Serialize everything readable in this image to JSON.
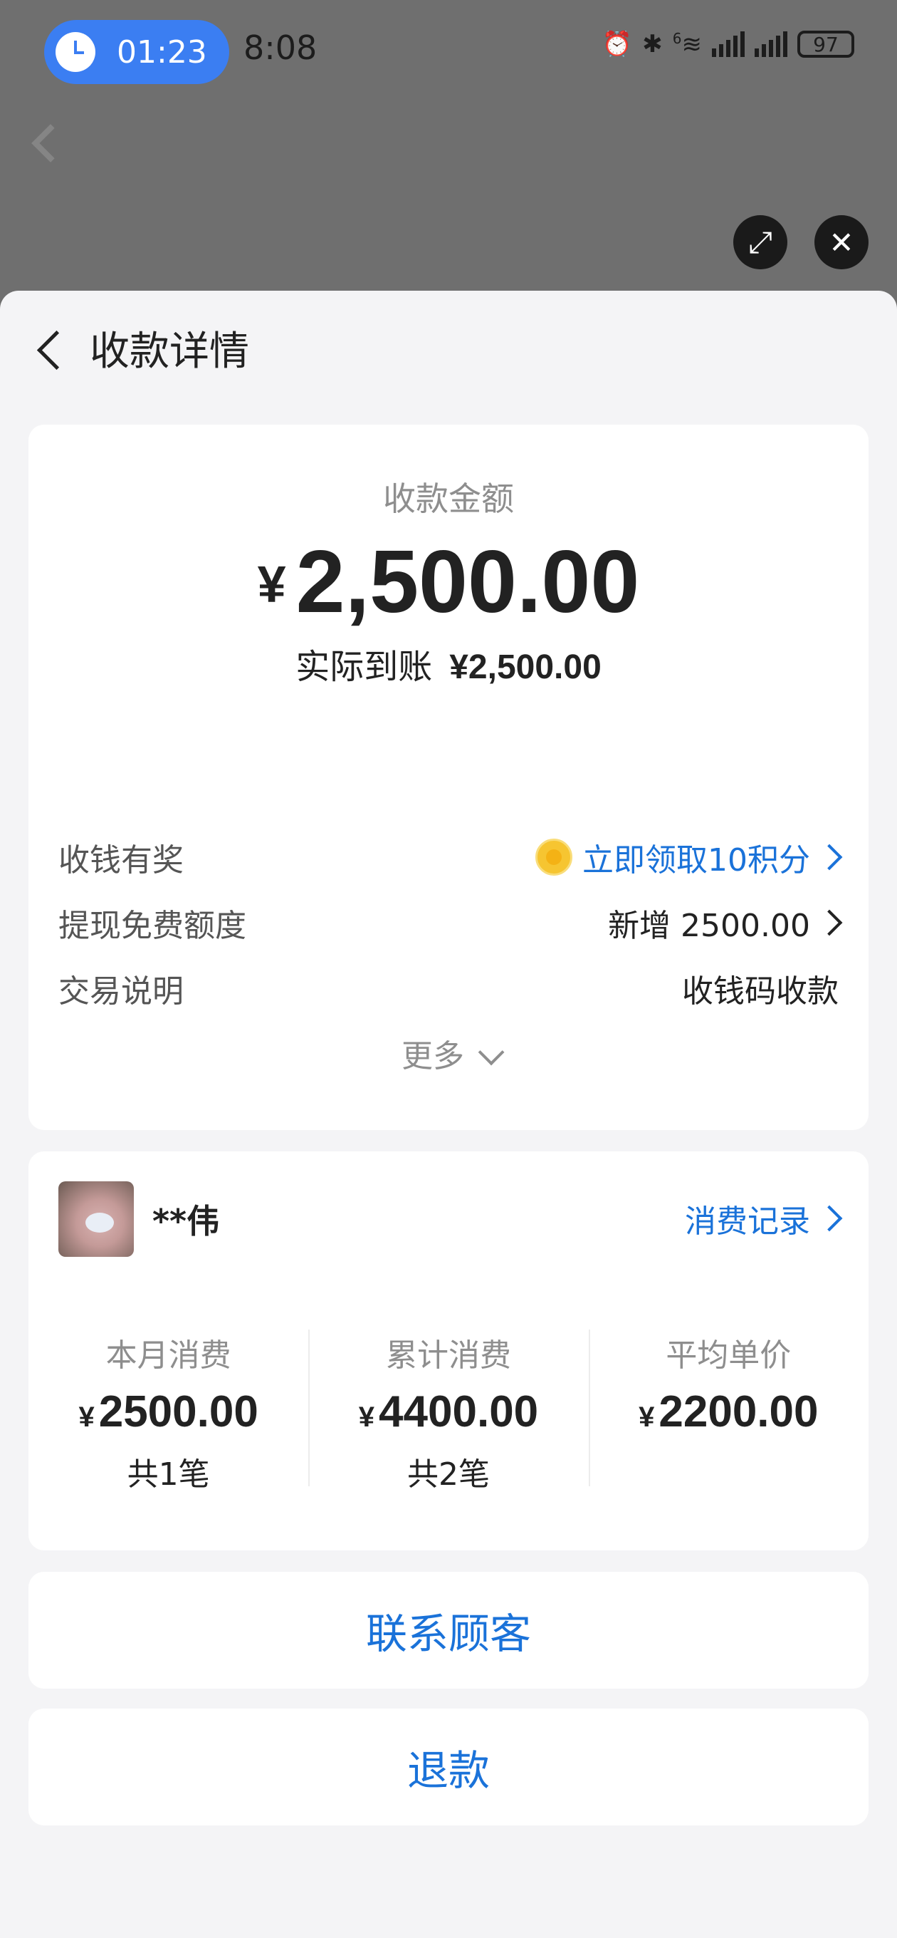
{
  "status_bar": {
    "alarm_time": "01:23",
    "time": "8:08",
    "battery": "97",
    "net_label": "6"
  },
  "header": {
    "title": "收款详情"
  },
  "amount_card": {
    "label": "收款金额",
    "currency": "¥",
    "amount": "2,500.00",
    "actual_label": "实际到账",
    "actual_amount": "¥2,500.00",
    "rows": [
      {
        "label": "收钱有奖",
        "value": "立即领取10积分"
      },
      {
        "label": "提现免费额度",
        "value": "新增 2500.00"
      },
      {
        "label": "交易说明",
        "value": "收钱码收款"
      }
    ],
    "more": "更多"
  },
  "customer_card": {
    "name": "**伟",
    "link": "消费记录",
    "stats": [
      {
        "label": "本月消费",
        "currency": "¥",
        "value": "2500.00",
        "count": "共1笔"
      },
      {
        "label": "累计消费",
        "currency": "¥",
        "value": "4400.00",
        "count": "共2笔"
      },
      {
        "label": "平均单价",
        "currency": "¥",
        "value": "2200.00",
        "count": ""
      }
    ]
  },
  "actions": {
    "contact": "联系顾客",
    "refund": "退款"
  },
  "colors": {
    "accent": "#1a72d9",
    "alarm": "#3b7ef2",
    "background": "#f4f4f6"
  }
}
